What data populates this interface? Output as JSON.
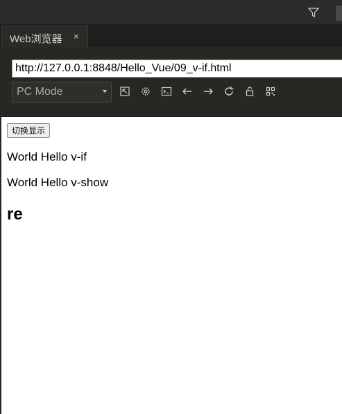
{
  "ide": {
    "tab": {
      "label": "Web浏览器",
      "close": "×"
    }
  },
  "browser": {
    "url": "http://127.0.0.1:8848/Hello_Vue/09_v-if.html",
    "mode": {
      "selected": "PC Mode"
    },
    "toolbar_icons": [
      "open-external-icon",
      "settings-gear-icon",
      "console-icon",
      "back-arrow-icon",
      "forward-arrow-icon",
      "refresh-icon",
      "lock-icon",
      "qr-code-icon"
    ]
  },
  "page": {
    "toggle_button": "切换显示",
    "line1": "World Hello v-if",
    "line2": "World Hello v-show",
    "heading": "re"
  },
  "colors": {
    "ide_background": "#262626",
    "toolbar": "#272822",
    "tab_active": "#2a2b26",
    "page_background": "#ffffff"
  }
}
